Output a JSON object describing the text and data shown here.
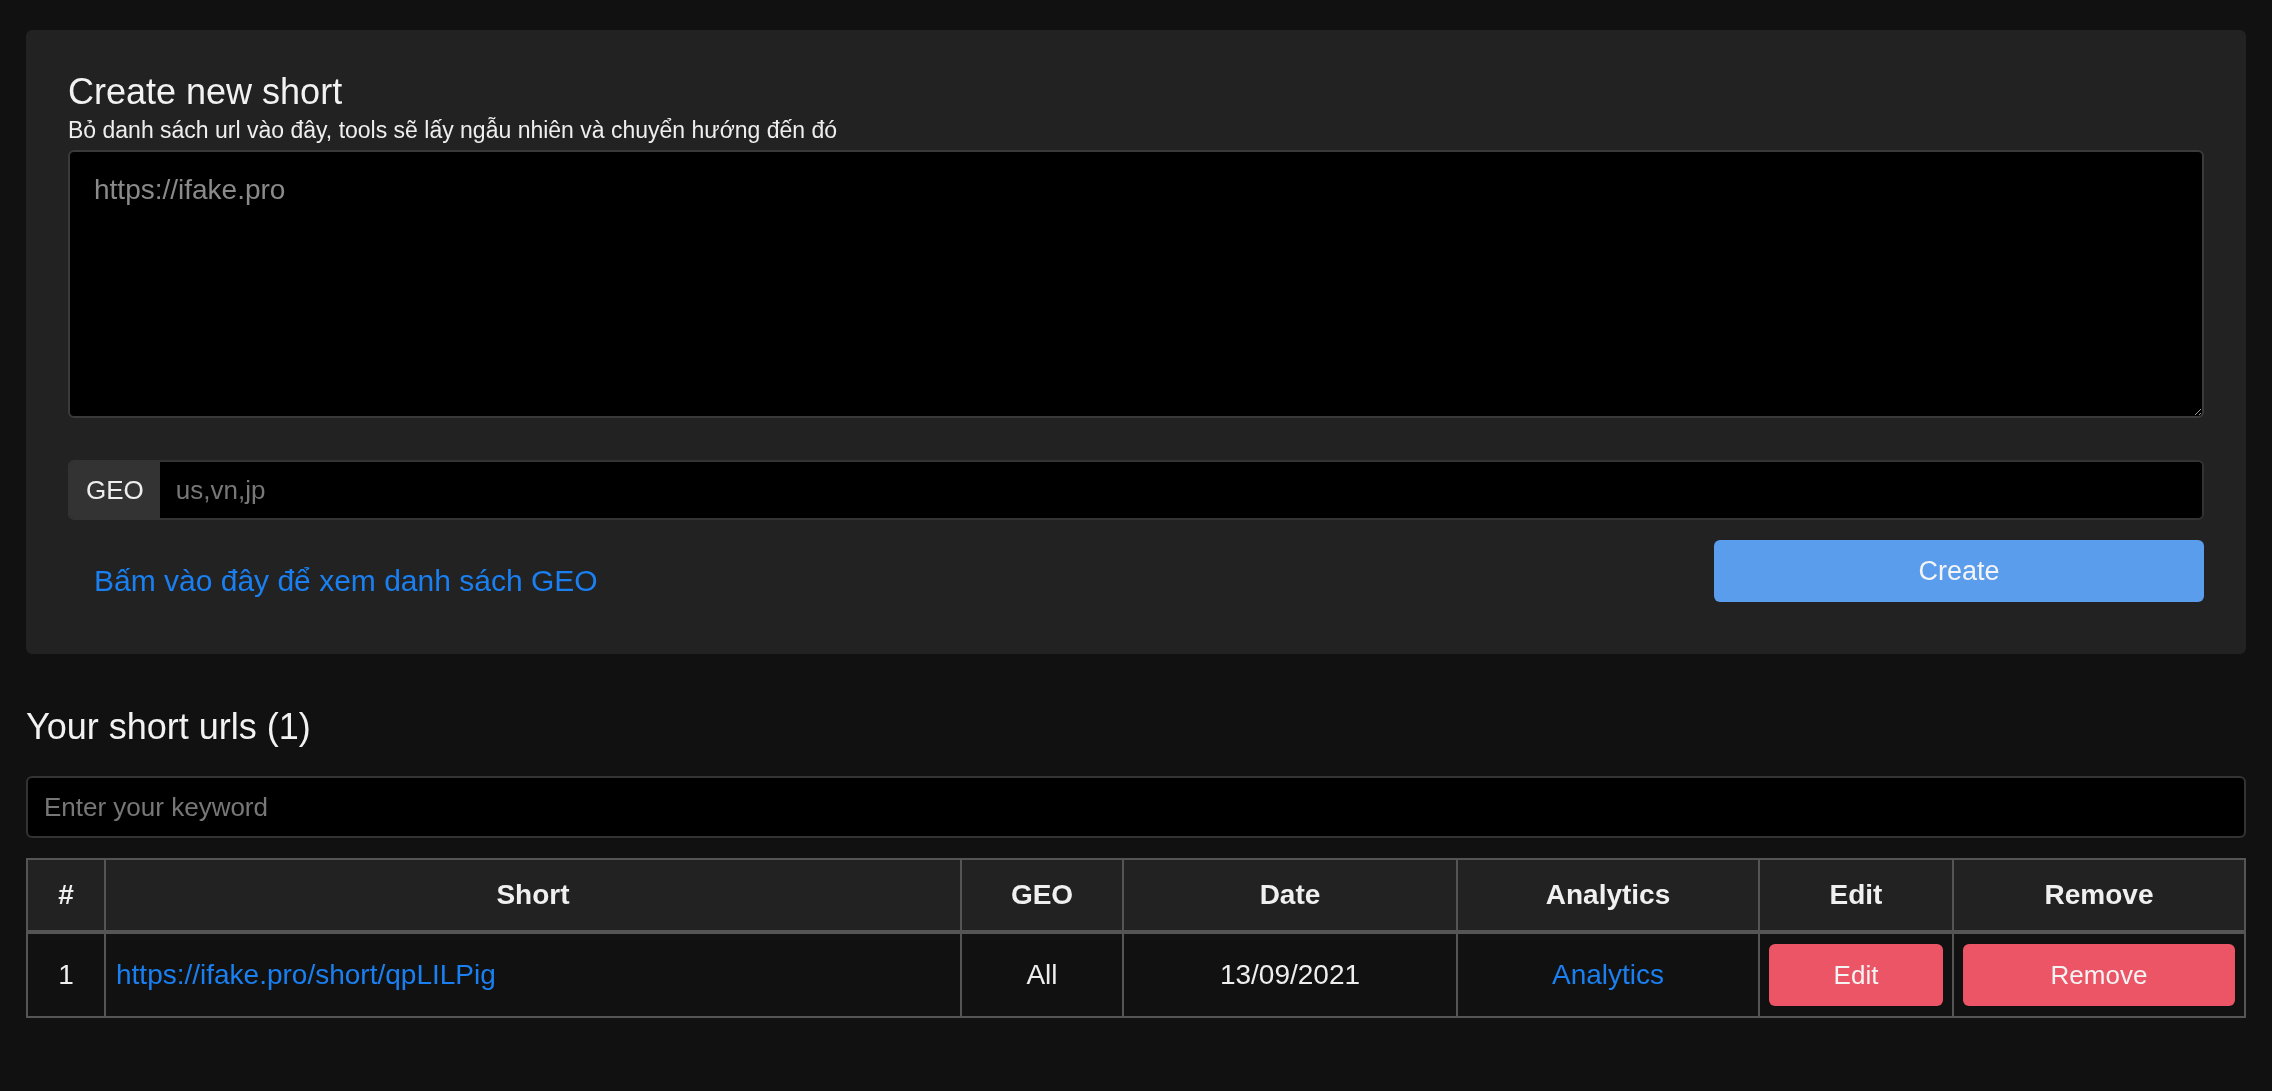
{
  "create_form": {
    "title": "Create new short",
    "description": "Bỏ danh sách url vào đây, tools sẽ lấy ngẫu nhiên và chuyển hướng đến đó",
    "urls_field": {
      "placeholder": "https://ifake.pro"
    },
    "geo_field": {
      "label": "GEO",
      "placeholder": "us,vn,jp"
    },
    "geo_list_link": "Bấm vào đây để xem danh sách GEO",
    "create_button": "Create"
  },
  "short_urls": {
    "title": "Your short urls (1)",
    "search": {
      "placeholder": "Enter your keyword"
    },
    "table": {
      "columns": [
        "#",
        "Short",
        "GEO",
        "Date",
        "Analytics",
        "Edit",
        "Remove"
      ],
      "rows": [
        {
          "number": "1",
          "short": "https://ifake.pro/short/qpLILPig",
          "geo": "All",
          "date": "13/09/2021",
          "analytics": "Analytics",
          "edit": "Edit",
          "remove": "Remove"
        }
      ]
    }
  }
}
